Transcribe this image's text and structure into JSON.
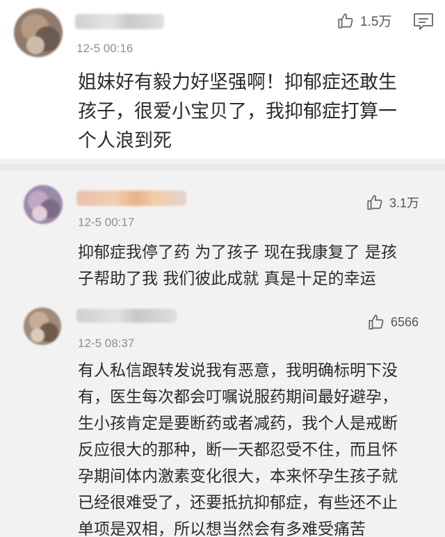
{
  "comments": [
    {
      "time": "12-5 00:16",
      "likes": "1.5万",
      "lines": [
        "姐妹好有毅力好坚强啊！抑郁症还敢生",
        "孩子，很爱小宝贝了，我抑郁症打算一",
        "个人浪到死"
      ],
      "icons": [
        "thumbs-up-icon",
        "comment-icon"
      ]
    },
    {
      "time": "12-5 00:17",
      "likes": "3.1万",
      "lines": [
        "抑郁症我停了药 为了孩子 现在我康复了 是孩",
        "子帮助了我 我们彼此成就 真是十足的幸运"
      ],
      "icons": [
        "thumbs-up-icon"
      ]
    },
    {
      "time": "12-5 08:37",
      "likes": "6566",
      "lines": [
        "有人私信跟转发说我有恶意，我明确标明下没",
        "有，医生每次都会叮嘱说服药期间最好避孕，",
        "生小孩肯定是要断药或者减药，我个人是戒断",
        "反应很大的那种，断一天都忍受不住，而且怀",
        "孕期间体内激素变化很大，本来怀孕生孩子就",
        "已经很难受了，还要抵抗抑郁症，有些还不止",
        "单项是双相，所以想当然会有多难受痛苦"
      ],
      "icons": [
        "thumbs-up-icon"
      ]
    }
  ],
  "colors": {
    "page_bg": "#ffffff",
    "reply_bg": "#f2f2f2",
    "text": "#2b2b2b",
    "meta": "#8e8e8e"
  }
}
